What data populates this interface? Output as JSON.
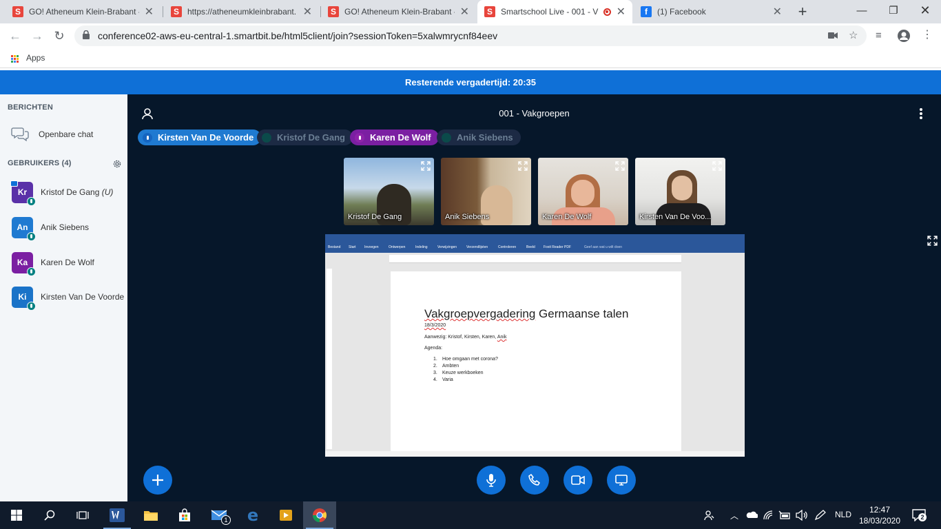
{
  "browser": {
    "tabs": [
      {
        "title": "GO! Atheneum Klein-Brabant -",
        "favicon": "smartschool-icon"
      },
      {
        "title": "https://atheneumkleinbrabant.",
        "favicon": "smartschool-icon"
      },
      {
        "title": "GO! Atheneum Klein-Brabant -",
        "favicon": "smartschool-icon"
      },
      {
        "title": "Smartschool Live - 001 - V",
        "favicon": "smartschool-icon",
        "active": true,
        "recording": true
      },
      {
        "title": "(1) Facebook",
        "favicon": "facebook-icon"
      }
    ],
    "url": "conference02-aws-eu-central-1.smartbit.be/html5client/join?sessionToken=5xalwmrycnf84eev",
    "bookmarks": {
      "apps_label": "Apps"
    }
  },
  "banner": {
    "text": "Resterende vergadertijd: 20:35",
    "color": "#0f70d7"
  },
  "sidebar": {
    "messages_title": "BERICHTEN",
    "public_chat": "Openbare chat",
    "users_title": "GEBRUIKERS (4)",
    "users": [
      {
        "initials": "Kr",
        "name": "Kristof De Gang",
        "suffix": "(U)",
        "color": "#5a31a8",
        "presenter": true
      },
      {
        "initials": "An",
        "name": "Anik Siebens",
        "suffix": "",
        "color": "#1f7ad1"
      },
      {
        "initials": "Ka",
        "name": "Karen De Wolf",
        "suffix": "",
        "color": "#7b1fa2"
      },
      {
        "initials": "Ki",
        "name": "Kirsten Van De Voorde",
        "suffix": "",
        "color": "#1a73c8"
      }
    ]
  },
  "main": {
    "meeting_title": "001 - Vakgroepen",
    "talkers": [
      {
        "name": "Kirsten Van De Voorde",
        "state": "talking",
        "color": "#1f7ad1"
      },
      {
        "name": "Kristof De Gang",
        "state": "muted"
      },
      {
        "name": "Karen De Wolf",
        "state": "talking",
        "color": "#7b1fa2"
      },
      {
        "name": "Anik Siebens",
        "state": "muted"
      }
    ],
    "videos": [
      {
        "name": "Kristof De Gang"
      },
      {
        "name": "Anik Siebens"
      },
      {
        "name": "Karen De Wolf"
      },
      {
        "name": "Kirsten Van De Voo..."
      }
    ]
  },
  "shared_document": {
    "ribbon_tabs": [
      "Bestand",
      "Start",
      "Invoegen",
      "Ontwerpen",
      "Indeling",
      "Verwijzingen",
      "Verzendlijsten",
      "Controleren",
      "Beeld",
      "Foxit Reader PDF",
      "Geef aan wat u wilt doen"
    ],
    "title_part1": "Vakgroepvergadering",
    "title_part2": " Germaanse talen",
    "date": "18/3/2020",
    "attendees_label": "Aanwezig: Kristof, Kirsten, Karen, ",
    "attendees_last": "Anik",
    "agenda_label": "Agenda:",
    "agenda": [
      {
        "num": "1.",
        "text": "Hoe omgaan met corona?"
      },
      {
        "num": "2.",
        "text": "Ambten"
      },
      {
        "num": "3.",
        "text": "Keuze werkboeken"
      },
      {
        "num": "4.",
        "text": "Varia"
      }
    ]
  },
  "taskbar": {
    "language": "NLD",
    "time": "12:47",
    "date": "18/03/2020",
    "notifications": "2",
    "mail_badge": "1"
  }
}
